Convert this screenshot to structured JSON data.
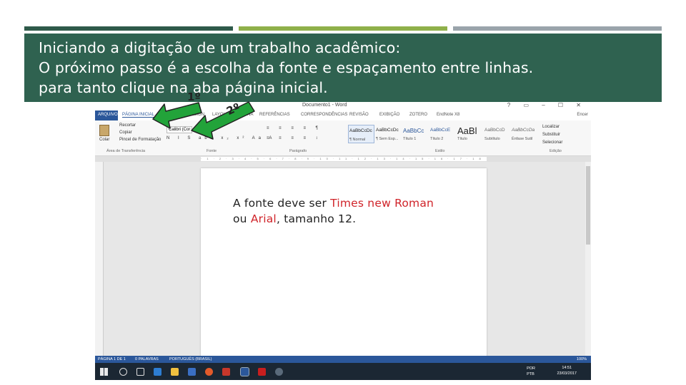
{
  "slide": {
    "title_lines": [
      "Iniciando a digitação de um trabalho acadêmico:",
      "O próximo passo é a escolha da fonte e espaçamento entre linhas.",
      "para tanto clique na aba página inicial."
    ],
    "annotation_1": "1º",
    "annotation_2": "2º",
    "note": {
      "before_times": "A fonte deve ser ",
      "times": "Times new Roman",
      "mid": "ou ",
      "arial": "Arial",
      "after": ", tamanho 12."
    },
    "colors": {
      "banner": "#2f6250",
      "bar_dark": "#2e5a4a",
      "bar_green": "#8fb04a",
      "bar_gray": "#9aa4ab",
      "arrow_green": "#22a33a",
      "highlight_red": "#d0242a",
      "word_blue": "#2b579a"
    }
  },
  "word": {
    "doc_title": "Documento1 - Word",
    "user": "Encer",
    "tabs": [
      "ARQUIVO",
      "PÁGINA INICIAL",
      "INSERIR",
      "DESIGN",
      "LAYOUT DA PÁGINA",
      "REFERÊNCIAS",
      "CORRESPONDÊNCIAS",
      "REVISÃO",
      "EXIBIÇÃO",
      "ZOTERO",
      "EndNote X8"
    ],
    "clipboard": {
      "paste": "Colar",
      "cut": "Recortar",
      "copy": "Copiar",
      "format_painter": "Pincel de Formatação",
      "label": "Área de Transferência"
    },
    "font": {
      "name": "Calibri (Cor",
      "label": "Fonte",
      "format_buttons": "N I S abc x₂ x² Aa A"
    },
    "paragraph_label": "Parágrafo",
    "styles": {
      "label": "Estilo",
      "items": [
        {
          "preview": "AaBbCcDc",
          "name": "¶ Normal"
        },
        {
          "preview": "AaBbCcDc",
          "name": "¶ Sem Esp..."
        },
        {
          "preview": "AaBbCc",
          "name": "Título 1"
        },
        {
          "preview": "AaBbCcE",
          "name": "Título 2"
        },
        {
          "preview": "AaBl",
          "name": "Título"
        },
        {
          "preview": "AaBbCcD",
          "name": "Subtítulo"
        },
        {
          "preview": "AaBbCcDa",
          "name": "Ênfase Sutil"
        }
      ]
    },
    "editing": {
      "find": "Localizar",
      "replace": "Substituir",
      "select": "Selecionar",
      "label": "Edição"
    },
    "status": {
      "page": "PÁGINA 1 DE 1",
      "words": "0 PALAVRAS",
      "lang": "PORTUGUÊS (BRASIL)",
      "zoom": "100%"
    },
    "taskbar": {
      "lang": "POR",
      "layout": "PTB",
      "time": "14:51",
      "date": "23/03/2017"
    }
  }
}
